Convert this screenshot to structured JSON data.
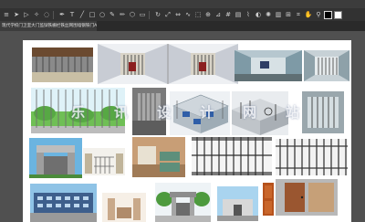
{
  "window": {
    "tab_title": "现代学校门卫室大门监狱铁栅栏铁丝网围墙钢铁门AI矢量素材 @ 50% (RGB/预览)"
  },
  "toolbar": {
    "icons": [
      "menu-icon",
      "move-icon",
      "selection-icon",
      "wand-icon",
      "lasso-icon",
      "pen-icon",
      "type-icon",
      "line-icon",
      "rectangle-icon",
      "brush-icon",
      "pencil-icon",
      "shaper-icon",
      "eraser-icon",
      "rotate-icon",
      "scale-icon",
      "width-icon",
      "warp-icon",
      "free-transform-icon",
      "shape-builder-icon",
      "perspective-icon",
      "mesh-icon",
      "gradient-icon",
      "eyedropper-icon",
      "blend-icon",
      "symbol-sprayer-icon",
      "graph-icon",
      "artboard-icon",
      "slice-icon",
      "hand-icon",
      "zoom-icon"
    ]
  },
  "watermark": {
    "chars": [
      "乐",
      "讯",
      "设",
      "计",
      "网",
      "站"
    ]
  },
  "colors": {
    "canvas": "#505050",
    "artboard": "#ffffff",
    "toolbar": "#323232",
    "tab": "#3c3c3c"
  }
}
